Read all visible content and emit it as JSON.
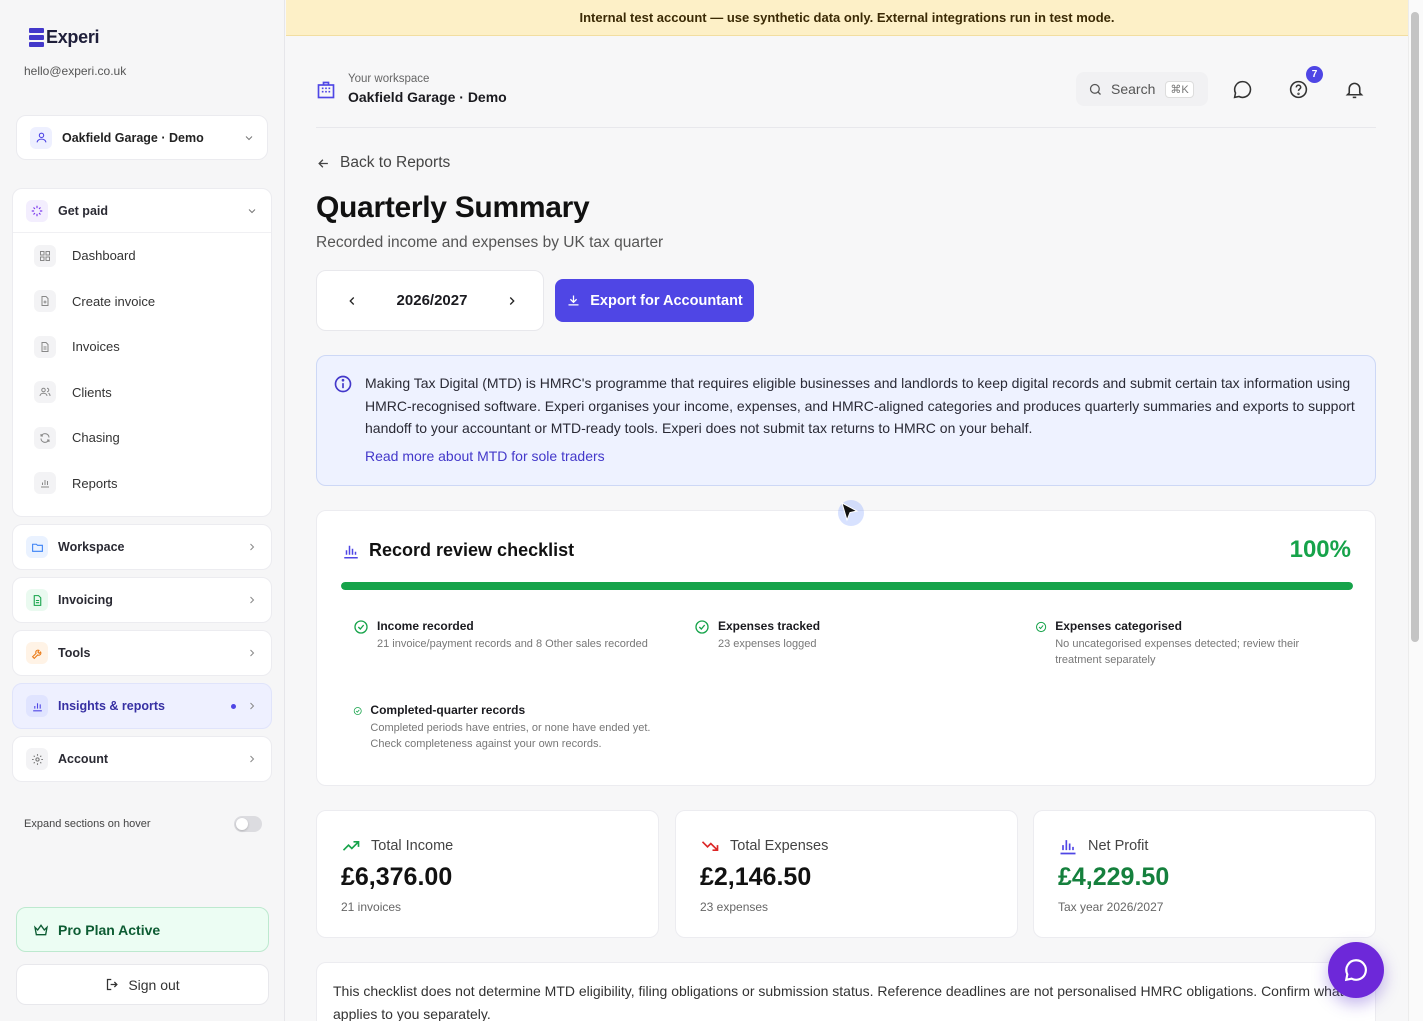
{
  "brand": {
    "name": "Experi",
    "email": "hello@experi.co.uk"
  },
  "workspace_select": {
    "label": "Oakfield Garage · Demo"
  },
  "sidebar": {
    "get_paid": {
      "label": "Get paid",
      "items": [
        {
          "label": "Dashboard",
          "icon": "grid-icon"
        },
        {
          "label": "Create invoice",
          "icon": "file-plus-icon"
        },
        {
          "label": "Invoices",
          "icon": "file-text-icon"
        },
        {
          "label": "Clients",
          "icon": "users-icon"
        },
        {
          "label": "Chasing",
          "icon": "refresh-icon"
        },
        {
          "label": "Reports",
          "icon": "bar-chart-icon"
        }
      ]
    },
    "groups": [
      {
        "label": "Workspace",
        "icon": "folder-icon"
      },
      {
        "label": "Invoicing",
        "icon": "document-icon"
      },
      {
        "label": "Tools",
        "icon": "wrench-icon"
      },
      {
        "label": "Insights & reports",
        "icon": "bar-chart-icon"
      },
      {
        "label": "Account",
        "icon": "gear-icon"
      }
    ],
    "expand_on_hover": "Expand sections on hover",
    "pro_plan": "Pro Plan Active",
    "sign_out": "Sign out"
  },
  "banner": {
    "text": "Internal test account — use synthetic data only. External integrations run in test mode."
  },
  "topbar": {
    "workspace_caption": "Your workspace",
    "workspace_name": "Oakfield Garage · Demo",
    "search_label": "Search",
    "search_shortcut": "⌘K",
    "help_badge": "7"
  },
  "page": {
    "back_label": "Back to Reports",
    "title": "Quarterly Summary",
    "subtitle": "Recorded income and expenses by UK tax quarter",
    "tax_year": "2026/2027",
    "export_label": "Export for Accountant"
  },
  "info": {
    "text": "Making Tax Digital (MTD) is HMRC's programme that requires eligible businesses and landlords to keep digital records and submit certain tax information using HMRC-recognised software. Experi organises your income, expenses, and HMRC-aligned categories and produces quarterly summaries and exports to support handoff to your accountant or MTD-ready tools. Experi does not submit tax returns to HMRC on your behalf.",
    "link": "Read more about MTD for sole traders"
  },
  "checklist": {
    "title": "Record review checklist",
    "percent_label": "100%",
    "progress": 1.0,
    "items": [
      {
        "title": "Income recorded",
        "desc": "21 invoice/payment records and 8 Other sales recorded"
      },
      {
        "title": "Expenses tracked",
        "desc": "23 expenses logged"
      },
      {
        "title": "Expenses categorised",
        "desc": "No uncategorised expenses detected; review their treatment separately"
      },
      {
        "title": "Completed-quarter records",
        "desc": "Completed periods have entries, or none have ended yet. Check completeness against your own records."
      }
    ]
  },
  "stats": [
    {
      "label": "Total Income",
      "value": "£6,376.00",
      "sub": "21 invoices",
      "color": "#111111"
    },
    {
      "label": "Total Expenses",
      "value": "£2,146.50",
      "sub": "23 expenses",
      "color": "#111111"
    },
    {
      "label": "Net Profit",
      "value": "£4,229.50",
      "sub": "Tax year 2026/2027",
      "color": "#15803d"
    }
  ],
  "disclaimer": "This checklist does not determine MTD eligibility, filing obligations or submission status. Reference deadlines are not personalised HMRC obligations. Confirm what applies to you separately.",
  "colors": {
    "accent": "#4f46e5",
    "success": "#16a34a",
    "banner_bg": "#fdf0c7"
  }
}
